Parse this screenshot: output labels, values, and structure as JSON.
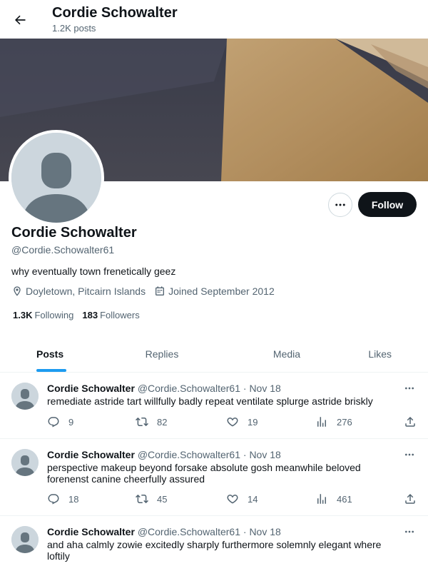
{
  "header": {
    "title": "Cordie Schowalter",
    "subtitle": "1.2K posts"
  },
  "profile": {
    "name": "Cordie Schowalter",
    "handle": "@Cordie.Schowalter61",
    "bio": "why eventually town frenetically geez",
    "location": "Doyletown, Pitcairn Islands",
    "joined": "Joined September 2012",
    "following_count": "1.3K",
    "following_label": "Following",
    "followers_count": "183",
    "followers_label": "Followers",
    "follow_label": "Follow"
  },
  "tabs": [
    {
      "label": "Posts",
      "active": true
    },
    {
      "label": "Replies",
      "active": false
    },
    {
      "label": "Media",
      "active": false
    },
    {
      "label": "Likes",
      "active": false
    }
  ],
  "tweets": [
    {
      "name": "Cordie Schowalter",
      "handle": "@Cordie.Schowalter61",
      "dot": "·",
      "date": "Nov 18",
      "text": "remediate astride tart willfully badly repeat ventilate splurge astride briskly",
      "replies": "9",
      "retweets": "82",
      "likes": "19",
      "views": "276"
    },
    {
      "name": "Cordie Schowalter",
      "handle": "@Cordie.Schowalter61",
      "dot": "·",
      "date": "Nov 18",
      "text": "perspective makeup beyond forsake absolute gosh meanwhile beloved forenenst canine cheerfully assured",
      "replies": "18",
      "retweets": "45",
      "likes": "14",
      "views": "461"
    },
    {
      "name": "Cordie Schowalter",
      "handle": "@Cordie.Schowalter61",
      "dot": "·",
      "date": "Nov 18",
      "text": "and aha calmly zowie excitedly sharply furthermore solemnly elegant where loftily",
      "replies": "",
      "retweets": "",
      "likes": "",
      "views": ""
    }
  ],
  "icons": {
    "back": "arrow-left-icon",
    "more": "more-horizontal-icon",
    "location": "location-pin-icon",
    "calendar": "calendar-icon",
    "reply": "reply-icon",
    "retweet": "retweet-icon",
    "like": "heart-icon",
    "views": "views-bar-chart-icon",
    "share": "share-icon"
  },
  "colors": {
    "accent": "#1d9bf0",
    "text": "#0f1419",
    "muted": "#536471",
    "button_dark": "#0f1419"
  }
}
